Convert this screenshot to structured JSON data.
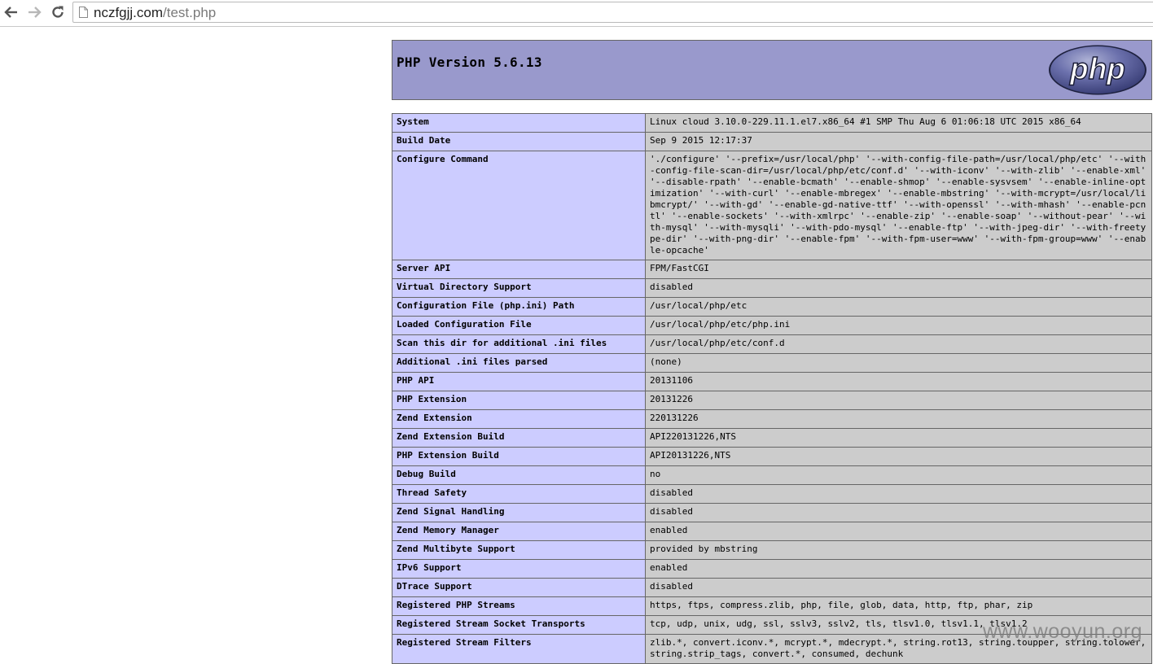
{
  "browser": {
    "url_host": "nczfgjj.com",
    "url_path": "/test.php"
  },
  "icons": {
    "back": "back-arrow-icon",
    "forward": "forward-arrow-icon",
    "reload": "reload-icon",
    "page": "page-icon",
    "logo": "php-logo"
  },
  "colors": {
    "header_bg": "#9999cc",
    "label_bg": "#ccccff",
    "value_bg": "#cccccc",
    "border": "#666666"
  },
  "header": {
    "title": "PHP Version 5.6.13",
    "logo_text": "php"
  },
  "rows": [
    {
      "label": "System",
      "value": "Linux cloud 3.10.0-229.11.1.el7.x86_64 #1 SMP Thu Aug 6 01:06:18 UTC 2015 x86_64"
    },
    {
      "label": "Build Date",
      "value": "Sep 9 2015 12:17:37"
    },
    {
      "label": "Configure Command",
      "value": "'./configure' '--prefix=/usr/local/php' '--with-config-file-path=/usr/local/php/etc' '--with-config-file-scan-dir=/usr/local/php/etc/conf.d' '--with-iconv' '--with-zlib' '--enable-xml' '--disable-rpath' '--enable-bcmath' '--enable-shmop' '--enable-sysvsem' '--enable-inline-optimization' '--with-curl' '--enable-mbregex' '--enable-mbstring' '--with-mcrypt=/usr/local/libmcrypt/' '--with-gd' '--enable-gd-native-ttf' '--with-openssl' '--with-mhash' '--enable-pcntl' '--enable-sockets' '--with-xmlrpc' '--enable-zip' '--enable-soap' '--without-pear' '--with-mysql' '--with-mysqli' '--with-pdo-mysql' '--enable-ftp' '--with-jpeg-dir' '--with-freetype-dir' '--with-png-dir' '--enable-fpm' '--with-fpm-user=www' '--with-fpm-group=www' '--enable-opcache'"
    },
    {
      "label": "Server API",
      "value": "FPM/FastCGI"
    },
    {
      "label": "Virtual Directory Support",
      "value": "disabled"
    },
    {
      "label": "Configuration File (php.ini) Path",
      "value": "/usr/local/php/etc"
    },
    {
      "label": "Loaded Configuration File",
      "value": "/usr/local/php/etc/php.ini"
    },
    {
      "label": "Scan this dir for additional .ini files",
      "value": "/usr/local/php/etc/conf.d"
    },
    {
      "label": "Additional .ini files parsed",
      "value": "(none)"
    },
    {
      "label": "PHP API",
      "value": "20131106"
    },
    {
      "label": "PHP Extension",
      "value": "20131226"
    },
    {
      "label": "Zend Extension",
      "value": "220131226"
    },
    {
      "label": "Zend Extension Build",
      "value": "API220131226,NTS"
    },
    {
      "label": "PHP Extension Build",
      "value": "API20131226,NTS"
    },
    {
      "label": "Debug Build",
      "value": "no"
    },
    {
      "label": "Thread Safety",
      "value": "disabled"
    },
    {
      "label": "Zend Signal Handling",
      "value": "disabled"
    },
    {
      "label": "Zend Memory Manager",
      "value": "enabled"
    },
    {
      "label": "Zend Multibyte Support",
      "value": "provided by mbstring"
    },
    {
      "label": "IPv6 Support",
      "value": "enabled"
    },
    {
      "label": "DTrace Support",
      "value": "disabled"
    },
    {
      "label": "Registered PHP Streams",
      "value": "https, ftps, compress.zlib, php, file, glob, data, http, ftp, phar, zip"
    },
    {
      "label": "Registered Stream Socket Transports",
      "value": "tcp, udp, unix, udg, ssl, sslv3, sslv2, tls, tlsv1.0, tlsv1.1, tlsv1.2"
    },
    {
      "label": "Registered Stream Filters",
      "value": "zlib.*, convert.iconv.*, mcrypt.*, mdecrypt.*, string.rot13, string.toupper, string.tolower, string.strip_tags, convert.*, consumed, dechunk"
    }
  ],
  "watermark": "www.wooyun.org"
}
